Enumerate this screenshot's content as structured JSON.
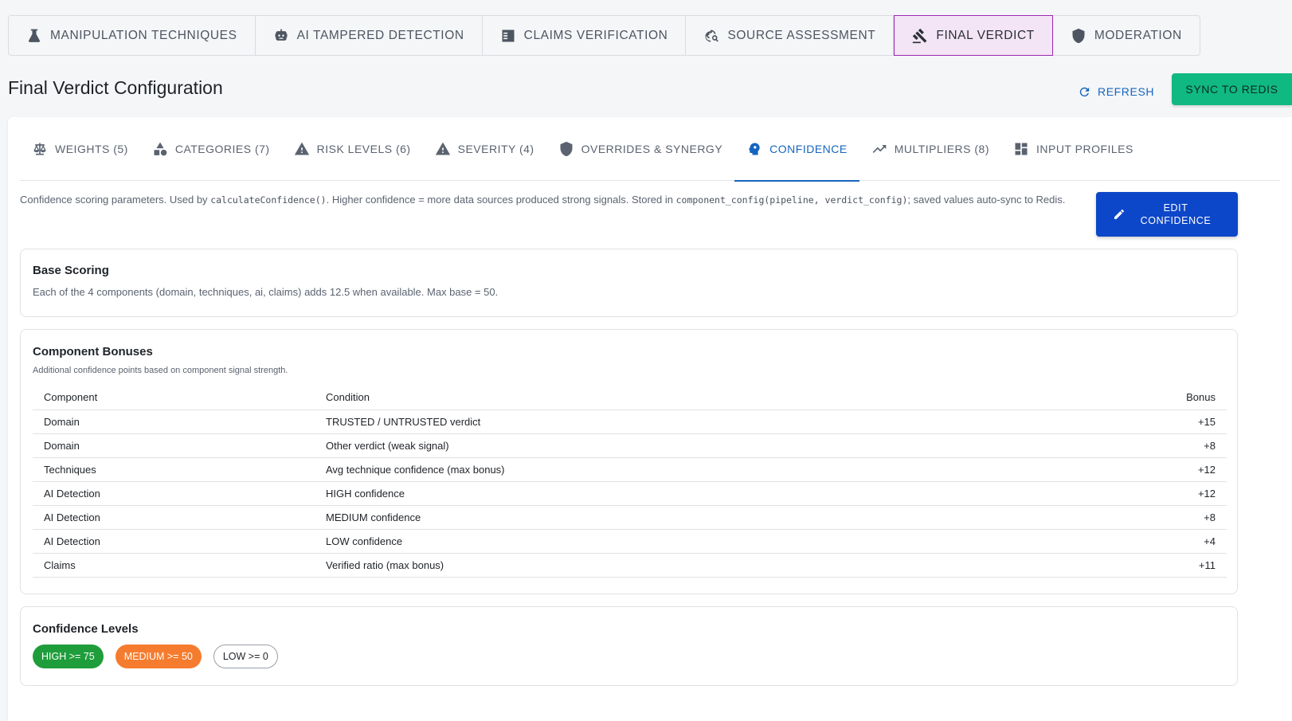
{
  "top_tabs": [
    {
      "label": "MANIPULATION TECHNIQUES",
      "icon": "flask-icon"
    },
    {
      "label": "AI TAMPERED DETECTION",
      "icon": "robot-icon"
    },
    {
      "label": "CLAIMS VERIFICATION",
      "icon": "fact-check-icon"
    },
    {
      "label": "SOURCE ASSESSMENT",
      "icon": "travel-explore-icon"
    },
    {
      "label": "FINAL VERDICT",
      "icon": "gavel-icon",
      "active": true
    },
    {
      "label": "MODERATION",
      "icon": "shield-icon"
    }
  ],
  "header": {
    "title": "Final Verdict Configuration",
    "refresh_label": "REFRESH",
    "sync_label": "SYNC TO REDIS"
  },
  "sub_tabs": [
    {
      "label": "WEIGHTS (5)",
      "icon": "scale-icon"
    },
    {
      "label": "CATEGORIES (7)",
      "icon": "category-icon"
    },
    {
      "label": "RISK LEVELS (6)",
      "icon": "warning-icon"
    },
    {
      "label": "SEVERITY (4)",
      "icon": "warning-icon"
    },
    {
      "label": "OVERRIDES & SYNERGY",
      "icon": "shield-icon"
    },
    {
      "label": "CONFIDENCE",
      "icon": "psychology-icon",
      "active": true
    },
    {
      "label": "MULTIPLIERS (8)",
      "icon": "trending-up-icon"
    },
    {
      "label": "INPUT PROFILES",
      "icon": "dashboard-icon"
    }
  ],
  "description": {
    "part1": "Confidence scoring parameters. Used by ",
    "code1": "calculateConfidence()",
    "part2": ". Higher confidence = more data sources produced strong signals. Stored in ",
    "code2": "component_config(pipeline, verdict_config)",
    "part3": "; saved values auto-sync to Redis."
  },
  "edit_button": {
    "line1": "EDIT",
    "line2": "CONFIDENCE"
  },
  "base_scoring": {
    "title": "Base Scoring",
    "text": "Each of the 4 components (domain, techniques, ai, claims) adds 12.5 when available. Max base = 50."
  },
  "component_bonuses": {
    "title": "Component Bonuses",
    "subtitle": "Additional confidence points based on component signal strength.",
    "headers": [
      "Component",
      "Condition",
      "Bonus"
    ],
    "rows": [
      [
        "Domain",
        "TRUSTED / UNTRUSTED verdict",
        "+15"
      ],
      [
        "Domain",
        "Other verdict (weak signal)",
        "+8"
      ],
      [
        "Techniques",
        "Avg technique confidence (max bonus)",
        "+12"
      ],
      [
        "AI Detection",
        "HIGH confidence",
        "+12"
      ],
      [
        "AI Detection",
        "MEDIUM confidence",
        "+8"
      ],
      [
        "AI Detection",
        "LOW confidence",
        "+4"
      ],
      [
        "Claims",
        "Verified ratio (max bonus)",
        "+11"
      ]
    ]
  },
  "confidence_levels": {
    "title": "Confidence Levels",
    "levels": [
      {
        "label": "HIGH >= 75",
        "color": "#1f9d3a"
      },
      {
        "label": "MEDIUM >= 50",
        "color": "#f57c2f"
      },
      {
        "label": "LOW >= 0",
        "color": "#ffffff"
      }
    ]
  }
}
